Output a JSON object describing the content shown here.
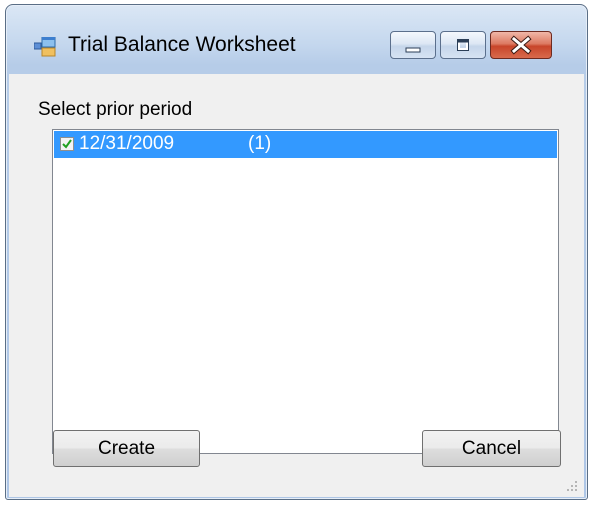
{
  "window": {
    "title": "Trial Balance Worksheet",
    "accent_color": "#3399ff"
  },
  "icons": {
    "app": "application-icon",
    "minimize": "minimize-icon",
    "maximize": "maximize-icon",
    "close": "close-icon",
    "checkmark": "checkmark-icon",
    "grip": "resize-grip-icon"
  },
  "form": {
    "label": "Select prior period",
    "periods": [
      {
        "date": "12/31/2009",
        "count": "(1)",
        "checked": true,
        "selected": true
      }
    ]
  },
  "buttons": {
    "create": "Create",
    "cancel": "Cancel"
  }
}
